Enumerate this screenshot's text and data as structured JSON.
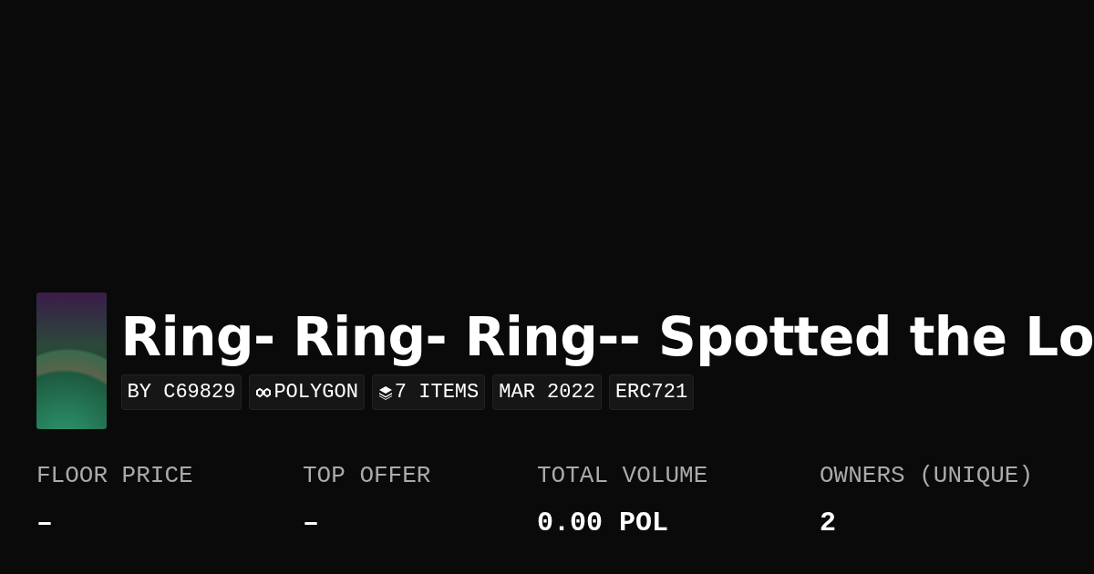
{
  "collection": {
    "title": "Ring- Ring- Ring-- Spotted the Lo",
    "tags": [
      {
        "kind": "plain",
        "label": "BY C69829"
      },
      {
        "kind": "chain",
        "label": "POLYGON"
      },
      {
        "kind": "items",
        "label": "7 ITEMS"
      },
      {
        "kind": "plain",
        "label": "MAR 2022"
      },
      {
        "kind": "plain",
        "label": "ERC721"
      }
    ]
  },
  "stats": [
    {
      "label": "FLOOR PRICE",
      "value": "–"
    },
    {
      "label": "TOP OFFER",
      "value": "–"
    },
    {
      "label": "TOTAL VOLUME",
      "value": "0.00 POL"
    },
    {
      "label": "OWNERS (UNIQUE)",
      "value": "2"
    }
  ]
}
